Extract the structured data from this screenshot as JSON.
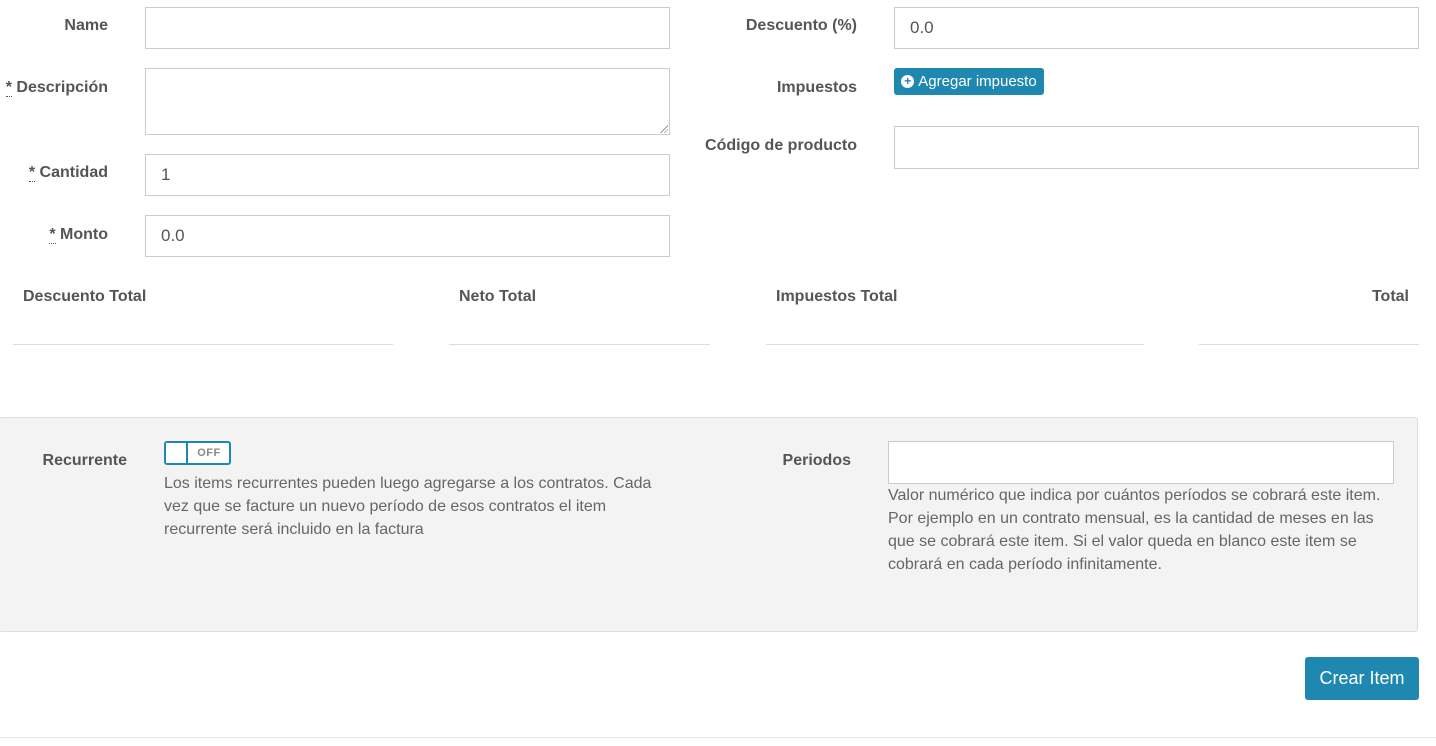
{
  "form": {
    "name_label": "Name",
    "name_value": "",
    "description_required": "*",
    "description_label": " Descripción",
    "description_value": "",
    "quantity_required": "*",
    "quantity_label": " Cantidad",
    "quantity_value": "1",
    "amount_required": "*",
    "amount_label": " Monto",
    "amount_value": "0.0",
    "discount_label": "Descuento (%)",
    "discount_value": "0.0",
    "taxes_label": "Impuestos",
    "add_tax_button": "Agregar impuesto",
    "product_code_label": "Código de producto",
    "product_code_value": ""
  },
  "totals": {
    "discount_total_label": "Descuento Total",
    "net_total_label": "Neto Total",
    "taxes_total_label": "Impuestos Total",
    "total_label": "Total"
  },
  "recurring": {
    "label": "Recurrente",
    "toggle_state": "OFF",
    "help_lines": [
      "Los items recurrentes pueden luego agregarse a los contratos. Cada",
      "vez que se facture un nuevo período de esos contratos el item",
      "recurrente será incluido en la factura"
    ],
    "periods_label": "Periodos",
    "periods_value": "",
    "periods_help_lines": [
      "Valor numérico que indica por cuántos períodos se cobrará este item.",
      "Por ejemplo en un contrato mensual, es la cantidad de meses en las",
      "que se cobrará este item. Si el valor queda en blanco este item se",
      "cobrará en cada período infinitamente."
    ]
  },
  "actions": {
    "create_button": "Crear Item"
  },
  "icons": {
    "add_tax_icon": "plus-circle-icon",
    "resize_icon": "resize-grip-icon"
  },
  "colors": {
    "accent": "#1f88b0",
    "panel_bg": "#f3f3f3",
    "label": "#555555"
  }
}
